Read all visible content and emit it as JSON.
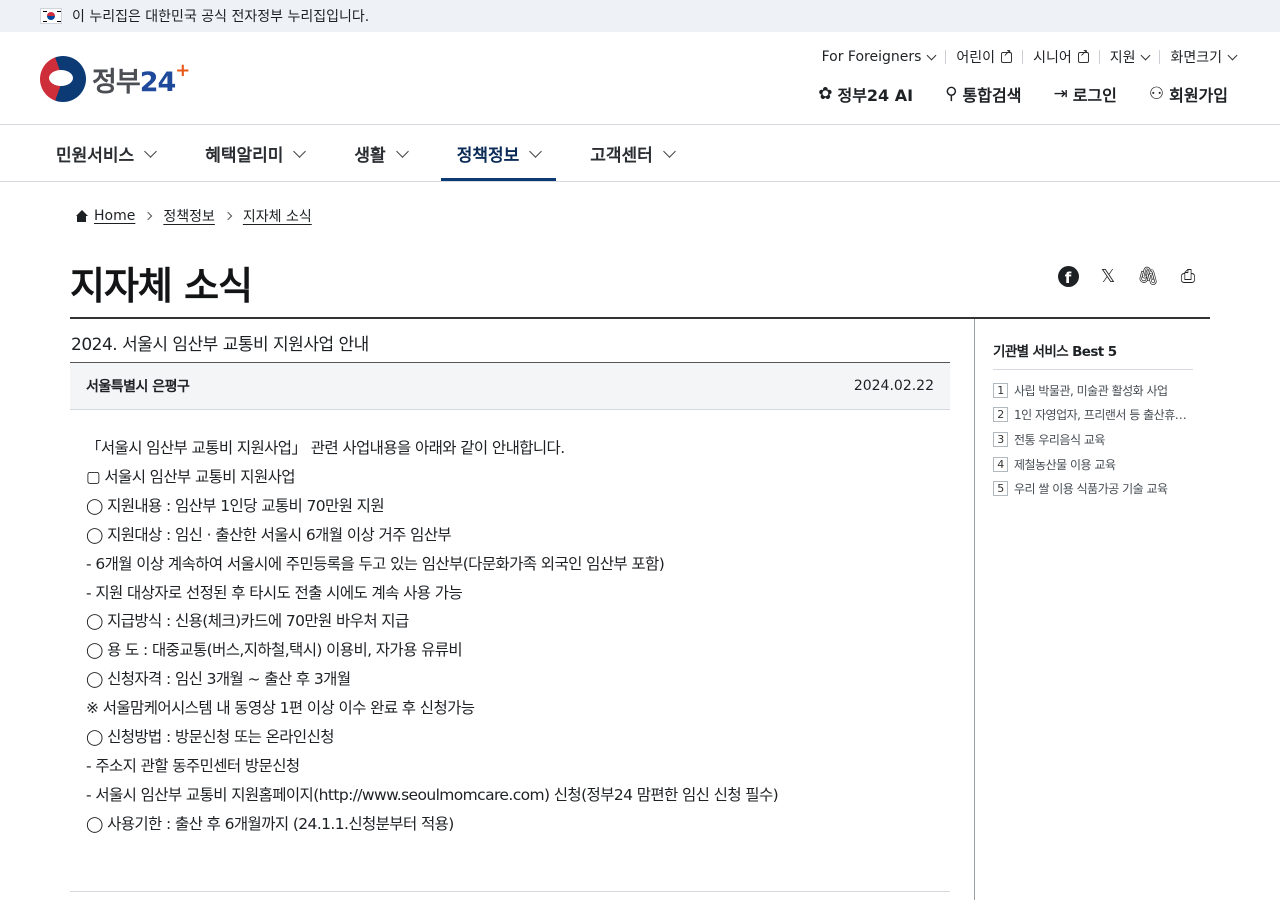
{
  "gov_banner": {
    "text": "이 누리집은 대한민국 공식 전자정부 누리집입니다."
  },
  "logo": {
    "text_a": "정부",
    "text_b": "24"
  },
  "utility": [
    {
      "label": "For Foreigners"
    },
    {
      "label": "어린이"
    },
    {
      "label": "시니어"
    },
    {
      "label": "지원"
    },
    {
      "label": "화면크기"
    }
  ],
  "actions": {
    "ai": "정부24 AI",
    "search": "통합검색",
    "login": "로그인",
    "signup": "회원가입"
  },
  "gnb": [
    {
      "label": "민원서비스"
    },
    {
      "label": "혜택알리미"
    },
    {
      "label": "생활"
    },
    {
      "label": "정책정보"
    },
    {
      "label": "고객센터"
    }
  ],
  "breadcrumb": {
    "home": "Home",
    "section": "정책정보",
    "current": "지자체 소식"
  },
  "page_title": "지자체 소식",
  "post": {
    "title": "2024. 서울시 임산부 교통비 지원사업 안내",
    "org": "서울특별시 은평구",
    "date": "2024.02.22",
    "lines": [
      "「서울시 임산부 교통비 지원사업」 관련 사업내용을 아래와 같이 안내합니다.",
      "▢ 서울시 임산부 교통비 지원사업",
      "◯ 지원내용 : 임산부 1인당 교통비 70만원 지원",
      "◯ 지원대상 : 임신 · 출산한 서울시 6개월 이상 거주 임산부",
      "- 6개월 이상 계속하여 서울시에 주민등록을 두고 있는 임산부(다문화가족 외국인 임산부 포함)",
      "- 지원 대상자로 선정된 후 타시도 전출 시에도 계속 사용 가능",
      "◯ 지급방식 : 신용(체크)카드에 70만원 바우처 지급",
      "◯ 용 도 : 대중교통(버스,지하철,택시) 이용비, 자가용 유류비",
      "◯ 신청자격 : 임신 3개월 ~ 출산 후 3개월",
      "※ 서울맘케어시스템 내 동영상 1편 이상 이수 완료 후 신청가능",
      "◯ 신청방법 : 방문신청 또는 온라인신청",
      "- 주소지 관할 동주민센터 방문신청",
      "- 서울시 임산부 교통비 지원홈페이지(http://www.seoulmomcare.com) 신청(정부24 맘편한 임신 신청 필수)",
      "◯ 사용기한 : 출산 후 6개월까지 (24.1.1.신청분부터 적용)"
    ]
  },
  "aside": {
    "title": "기관별 서비스 Best 5",
    "items": [
      {
        "num": "1",
        "text": "사립 박물관, 미술관 활성화 사업"
      },
      {
        "num": "2",
        "text": "1인 자영업자, 프리랜서 등 출산휴가…"
      },
      {
        "num": "3",
        "text": "전통 우리음식 교육"
      },
      {
        "num": "4",
        "text": "제철농산물 이용 교육"
      },
      {
        "num": "5",
        "text": "우리 쌀 이용 식품가공 기술 교육"
      }
    ]
  }
}
